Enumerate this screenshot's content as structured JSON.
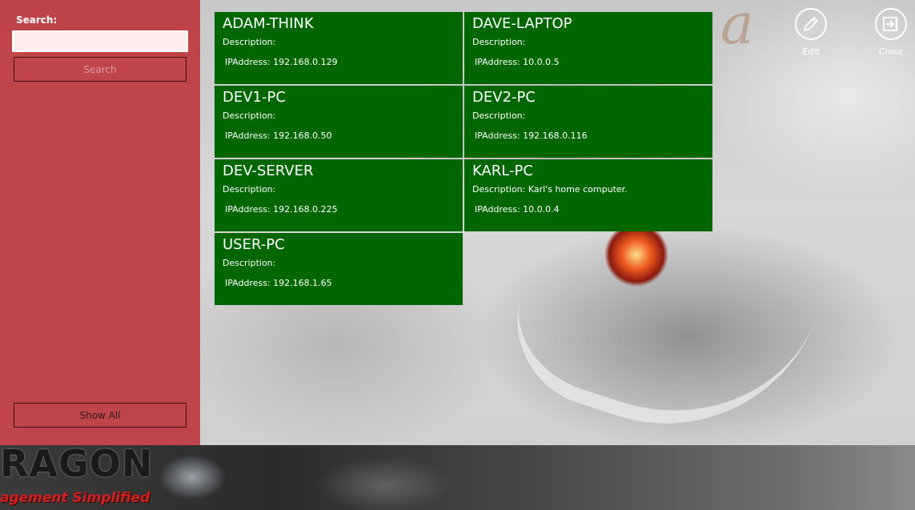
{
  "sidebar": {
    "search_label": "Search:",
    "search_value": "",
    "search_button": "Search",
    "show_all_button": "Show All"
  },
  "devices": [
    {
      "name": "ADAM-THINK",
      "description": "Description:",
      "ip": "IPAddress: 192.168.0.129"
    },
    {
      "name": "DAVE-LAPTOP",
      "description": "Description:",
      "ip": "IPAddress: 10.0.0.5"
    },
    {
      "name": "DEV1-PC",
      "description": "Description:",
      "ip": "IPAddress: 192.168.0.50"
    },
    {
      "name": "DEV2-PC",
      "description": "Description:",
      "ip": "IPAddress: 192.168.0.116"
    },
    {
      "name": "DEV-SERVER",
      "description": "Description:",
      "ip": "IPAddress: 192.168.0.225"
    },
    {
      "name": "KARL-PC",
      "description": "Description: Karl's home computer.",
      "ip": "IPAddress: 10.0.0.4"
    },
    {
      "name": "USER-PC",
      "description": "Description:",
      "ip": "IPAddress: 192.168.1.65"
    }
  ],
  "appbar": {
    "brand_name": "RAGON",
    "brand_tagline": "agement Simplified",
    "commands": [
      {
        "label": "Edit",
        "icon": "pencil-icon"
      },
      {
        "label": "Close",
        "icon": "exit-icon"
      }
    ]
  },
  "colors": {
    "sidebar": "#be3a40",
    "tile": "#006600",
    "tagline": "#d21f1f"
  }
}
